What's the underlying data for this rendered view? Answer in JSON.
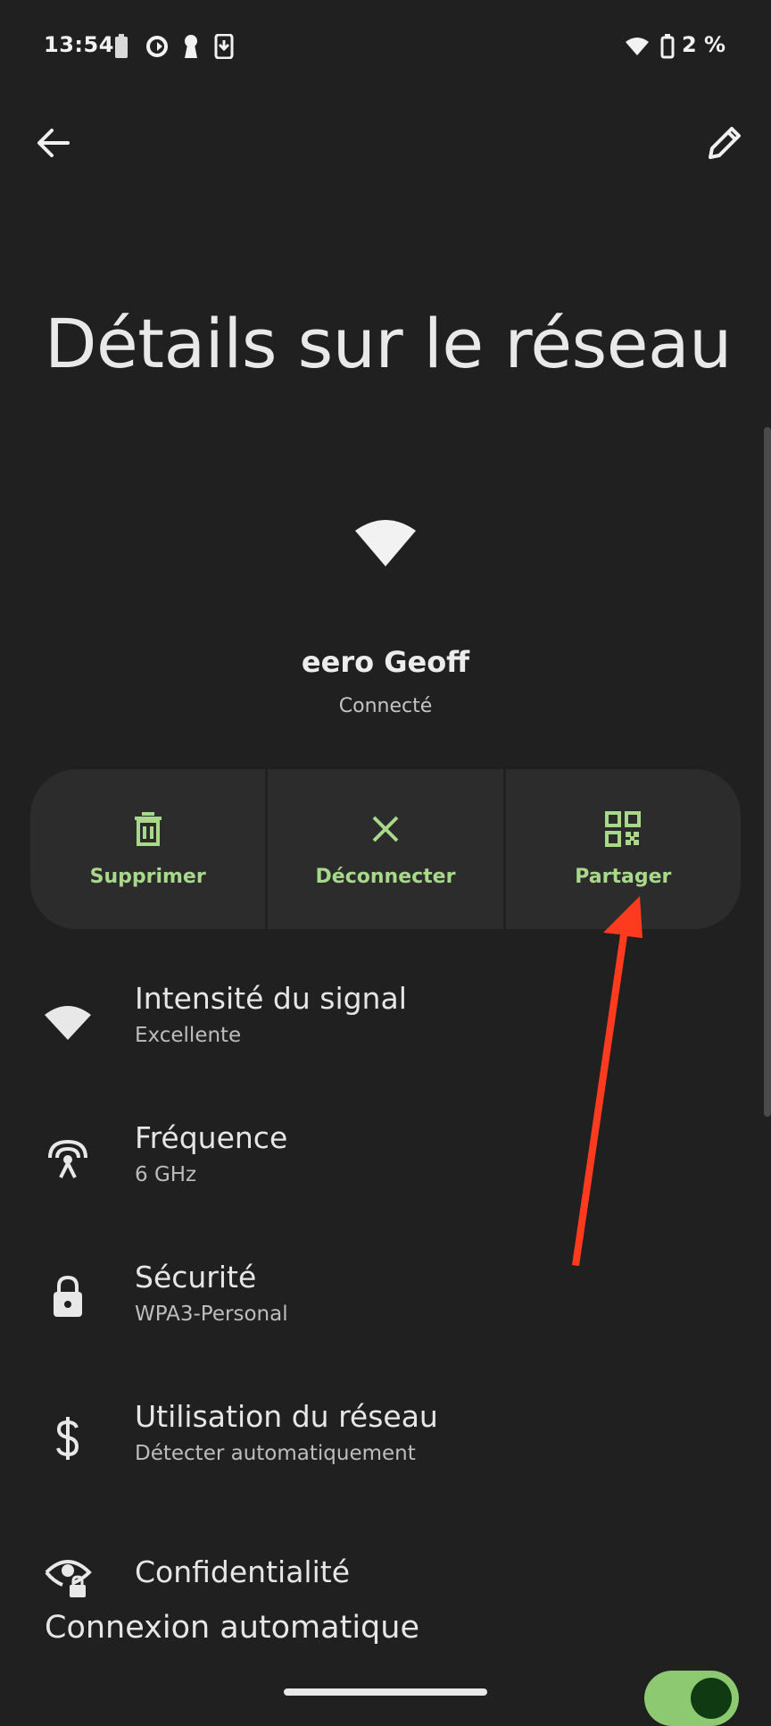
{
  "status_bar": {
    "time": "13:54",
    "battery_text": "2 %",
    "icons_left": [
      "battery-saver-icon",
      "sync-icon",
      "keyhole-icon",
      "download-icon"
    ],
    "icons_right": [
      "wifi-icon",
      "battery-icon"
    ]
  },
  "header": {
    "back_icon": "arrow-left-icon",
    "edit_icon": "pencil-icon",
    "title": "Détails sur le réseau"
  },
  "network": {
    "name": "eero Geoff",
    "status": "Connecté"
  },
  "actions": [
    {
      "label": "Supprimer",
      "icon": "trash-icon"
    },
    {
      "label": "Déconnecter",
      "icon": "close-icon"
    },
    {
      "label": "Partager",
      "icon": "qr-code-icon"
    }
  ],
  "details": [
    {
      "title": "Intensité du signal",
      "subtitle": "Excellente",
      "icon": "wifi-icon"
    },
    {
      "title": "Fréquence",
      "subtitle": "6 GHz",
      "icon": "antenna-icon"
    },
    {
      "title": "Sécurité",
      "subtitle": "WPA3-Personal",
      "icon": "lock-icon"
    },
    {
      "title": "Utilisation du réseau",
      "subtitle": "Détecter automatiquement",
      "icon": "dollar-icon"
    },
    {
      "title": "Confidentialité",
      "subtitle": "",
      "icon": "eye-lock-icon"
    }
  ],
  "auto_connect": {
    "label": "Connexion automatique",
    "enabled": true
  },
  "colors": {
    "background": "#202020",
    "action_surface": "#2c2c2c",
    "accent_green": "#a8d98a",
    "toggle_track": "#8cc970",
    "annotation_arrow": "#ff3b1f"
  }
}
